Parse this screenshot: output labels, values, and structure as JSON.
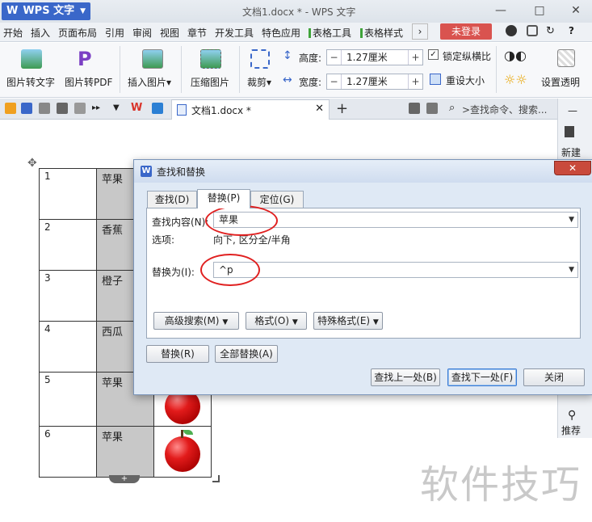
{
  "app": {
    "wps_button": "WPS 文字",
    "doc_title": "文档1.docx * - WPS 文字",
    "minimize": "—",
    "restore": "□",
    "close": "✕"
  },
  "menu": {
    "items": [
      "开始",
      "插入",
      "页面布局",
      "引用",
      "审阅",
      "视图",
      "章节",
      "开发工具",
      "特色应用",
      "表格工具",
      "表格样式"
    ],
    "more": "›",
    "login": "未登录",
    "help": "?"
  },
  "ribbon": {
    "pic_to_text": "图片转文字",
    "pic_to_pdf": "图片转PDF",
    "insert_pic": "插入图片",
    "insert_pic_arrow": "▾",
    "compress_pic": "压缩图片",
    "crop": "裁剪",
    "crop_arrow": "▾",
    "height_label": "高度:",
    "height_value": "1.27厘米",
    "width_label": "宽度:",
    "width_value": "1.27厘米",
    "lock_ratio": "锁定纵横比",
    "reset_size": "重设大小",
    "set_transparent": "设置透明"
  },
  "tabbar": {
    "doc_tab": "文档1.docx *",
    "add_tab": "+",
    "search_placeholder": ">查找命令、搜索..."
  },
  "rightpanel": {
    "new": "新建",
    "recommend": "推荐"
  },
  "table": {
    "rows": [
      {
        "num": "1",
        "fruit": "苹果"
      },
      {
        "num": "2",
        "fruit": "香蕉"
      },
      {
        "num": "3",
        "fruit": "橙子"
      },
      {
        "num": "4",
        "fruit": "西瓜"
      },
      {
        "num": "5",
        "fruit": "苹果"
      },
      {
        "num": "6",
        "fruit": "苹果"
      }
    ]
  },
  "dialog": {
    "title": "查找和替换",
    "close": "✕",
    "tabs": [
      "查找(D)",
      "替换(P)",
      "定位(G)"
    ],
    "find_label": "查找内容(N):",
    "find_value": "苹果",
    "options_label": "选项:",
    "options_value": "向下, 区分全/半角",
    "replace_label": "替换为(I):",
    "replace_value": "^p",
    "advanced_search": "高级搜索(M)",
    "format": "格式(O)",
    "special_format": "特殊格式(E)",
    "replace_btn": "替换(R)",
    "replace_all_btn": "全部替换(A)",
    "find_prev": "查找上一处(B)",
    "find_next": "查找下一处(F)",
    "close_btn": "关闭"
  },
  "watermark": "软件技巧",
  "colors": {
    "accent": "#3a67c9",
    "login_red": "#d9534f",
    "annotation_red": "#e02020"
  }
}
